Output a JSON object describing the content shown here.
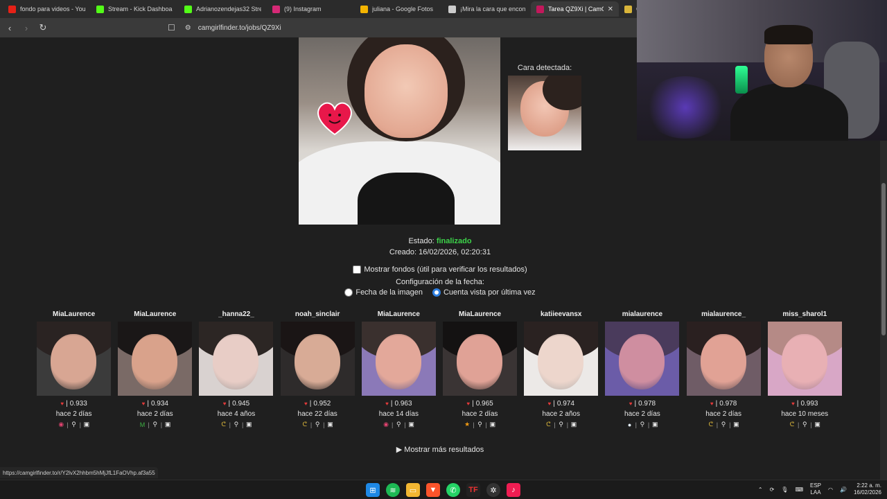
{
  "browser": {
    "tabs": [
      {
        "label": "fondo para videos - YouTu",
        "color": "#e62117",
        "active": false
      },
      {
        "label": "Stream - Kick Dashboa",
        "color": "#53fc18",
        "active": false
      },
      {
        "label": "Adrianozendejas32 Stream",
        "color": "#53fc18",
        "active": false
      },
      {
        "label": "(9) Instagram",
        "color": "#d62976",
        "active": false
      },
      {
        "label": "juliana - Google Fotos",
        "color": "#f4b400",
        "active": false
      },
      {
        "label": "¡Mira la cara que encontré",
        "color": "#cccccc",
        "active": false
      },
      {
        "label": "Tarea QZ9Xi | CamGirl",
        "color": "#c2185b",
        "active": true
      },
      {
        "label": "C",
        "color": "#d9b53a",
        "active": false
      }
    ],
    "url": "camgirlfinder.to/jobs/QZ9Xi",
    "status_url": "https://camgirlfinder.to/r/Y2lvX2hhbm5hMjJfL1FaOVhp.af3a55"
  },
  "job": {
    "detected_face_label": "Cara detectada:",
    "estado_label": "Estado:",
    "estado_value": "finalizado",
    "creado": "Creado: 16/02/2026, 02:20:31",
    "show_backgrounds_label": "Mostrar fondos (útil para verificar los resultados)",
    "date_config_label": "Configuración de la fecha:",
    "radio_image_date": "Fecha de la imagen",
    "radio_last_seen": "Cuenta vista por última vez",
    "more_results": "▶ Mostrar más resultados"
  },
  "results": [
    {
      "username": "MiaLaurence",
      "score": "0.933",
      "ago": "hace 2 días",
      "platform": "◉",
      "platform_color": "#e0436f",
      "skin": "#d8a693",
      "hair": "#2a2322",
      "bg": "#3b3b3b"
    },
    {
      "username": "MiaLaurence",
      "score": "0.934",
      "ago": "hace 2 días",
      "platform": "M",
      "platform_color": "#3cb043",
      "skin": "#d9a28b",
      "hair": "#1a1717",
      "bg": "#7a6a66"
    },
    {
      "username": "_hanna22_",
      "score": "0.945",
      "ago": "hace 4 años",
      "platform": "ᕦ",
      "platform_color": "#d9b53a",
      "skin": "#e8cdc6",
      "hair": "#2c2624",
      "bg": "#d9d2d0"
    },
    {
      "username": "noah_sinclair",
      "score": "0.952",
      "ago": "hace 22 días",
      "platform": "ᕦ",
      "platform_color": "#d9b53a",
      "skin": "#d8ab96",
      "hair": "#1a1515",
      "bg": "#2e2b2b"
    },
    {
      "username": "MiaLaurence",
      "score": "0.963",
      "ago": "hace 14 días",
      "platform": "◉",
      "platform_color": "#e0436f",
      "skin": "#e3a89a",
      "hair": "#3a302e",
      "bg": "#8b79b8"
    },
    {
      "username": "MiaLaurence",
      "score": "0.965",
      "ago": "hace 2 días",
      "platform": "★",
      "platform_color": "#f39c12",
      "skin": "#e0a296",
      "hair": "#141212",
      "bg": "#3a3434"
    },
    {
      "username": "katiieevansx",
      "score": "0.974",
      "ago": "hace 2 años",
      "platform": "ᕦ",
      "platform_color": "#d9b53a",
      "skin": "#edd6cc",
      "hair": "#2a2221",
      "bg": "#ece9e7"
    },
    {
      "username": "mialaurence",
      "score": "0.978",
      "ago": "hace 2 días",
      "platform": "●",
      "platform_color": "#e8f4ff",
      "skin": "#cf8ea0",
      "hair": "#4a3b5c",
      "bg": "#6b5ca8"
    },
    {
      "username": "mialaurence_",
      "score": "0.978",
      "ago": "hace 2 días",
      "platform": "ᕦ",
      "platform_color": "#d9b53a",
      "skin": "#e1a295",
      "hair": "#2a2020",
      "bg": "#6f5c66"
    },
    {
      "username": "miss_sharol1",
      "score": "0.993",
      "ago": "hace 10 meses",
      "platform": "ᕦ",
      "platform_color": "#d9b53a",
      "skin": "#e8b0b4",
      "hair": "#b58a86",
      "bg": "#d8a7c6"
    }
  ],
  "taskbar": {
    "lang_top": "ESP",
    "lang_bottom": "LAA",
    "time": "2:22 a. m.",
    "date": "16/02/2026",
    "apps": [
      "windows-start",
      "spotify",
      "file-explorer",
      "brave",
      "whatsapp",
      "tf",
      "chatgpt",
      "tiktok"
    ]
  }
}
